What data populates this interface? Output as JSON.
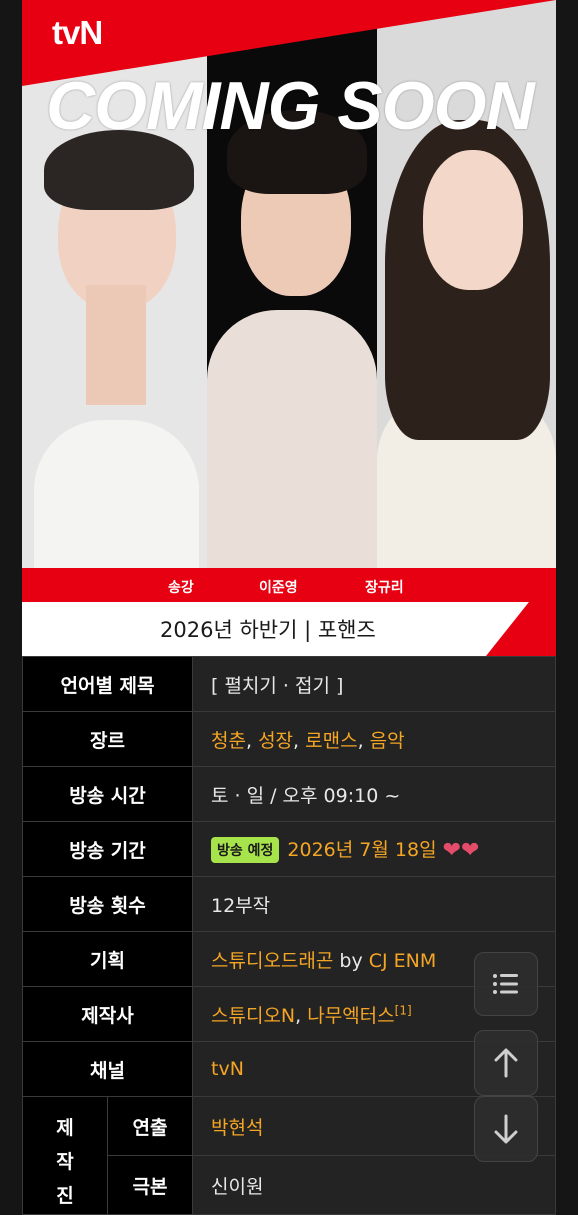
{
  "poster": {
    "logo": "tvN",
    "headline": "COMING SOON",
    "cast": [
      "송강",
      "이준영",
      "장규리"
    ],
    "subtitle": "2026년 하반기 | 포핸즈"
  },
  "info": {
    "title_label": "언어별 제목",
    "title_value": "[ 펼치기 · 접기 ]",
    "genre_label": "장르",
    "genre_items": [
      "청춘",
      "성장",
      "로맨스",
      "음악"
    ],
    "genre_sep": ", ",
    "time_label": "방송 시간",
    "time_value": "토 · 일 / 오후 09:10 ~",
    "period_label": "방송 기간",
    "period_badge": "방송 예정",
    "period_value": "2026년 7월 18일",
    "period_hearts": "❤❤",
    "episodes_label": "방송 횟수",
    "episodes_value": "12부작",
    "planning_label": "기획",
    "planning_value": "스튜디오드래곤",
    "planning_by": " by ",
    "planning_company": "CJ ENM",
    "production_label": "제작사",
    "production_a": "스튜디오N",
    "production_sep": ", ",
    "production_b": "나무엑터스",
    "production_ref": "[1]",
    "channel_label": "채널",
    "channel_value": "tvN",
    "crew_label": "제작진",
    "director_label": "연출",
    "director_value": "박현석",
    "writer_label": "극본",
    "writer_value": "신이원"
  },
  "colors": {
    "brand_red": "#e60012",
    "link_orange": "#f5a524",
    "badge_green": "#a7e34b"
  },
  "icons": [
    "toc-icon",
    "arrow-up-icon",
    "arrow-down-icon"
  ]
}
